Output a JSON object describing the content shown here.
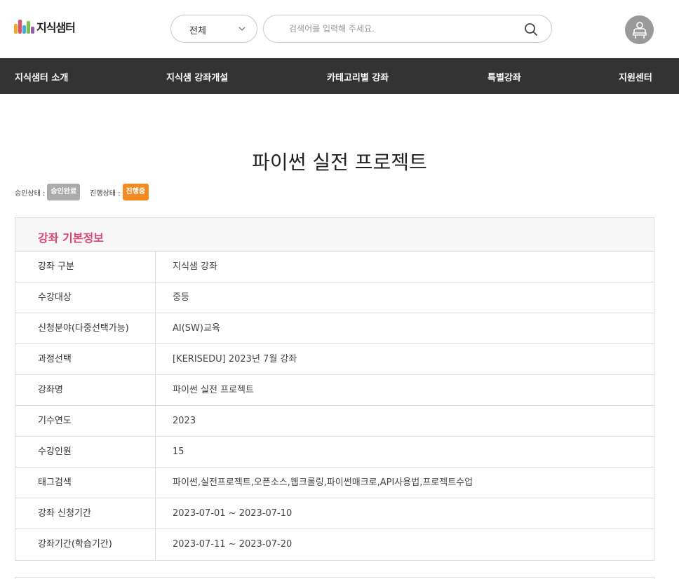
{
  "header": {
    "logo_text": "지식샘터",
    "category_select": {
      "selected": "전체"
    },
    "search": {
      "placeholder": "검색어를 입력해 주세요.",
      "value": ""
    }
  },
  "nav": {
    "items": [
      {
        "label": "지식샘터 소개"
      },
      {
        "label": "지식샘 강좌개설"
      },
      {
        "label": "카테고리별 강좌"
      },
      {
        "label": "특별강좌"
      },
      {
        "label": "지원센터"
      }
    ]
  },
  "course": {
    "title": "파이썬 실전 프로젝트",
    "approval_label": "승인상태 :",
    "approval_value": "승인완료",
    "progress_label": "진행상태 :",
    "progress_value": "진행중"
  },
  "info": {
    "heading": "강좌 기본정보",
    "rows": [
      {
        "key": "강좌 구분",
        "value": "지식샘 강좌"
      },
      {
        "key": "수강대상",
        "value": "중등"
      },
      {
        "key": "신청분야(다중선택가능)",
        "value": "AI(SW)교육"
      },
      {
        "key": "과정선택",
        "value": "[KERISEDU] 2023년 7월 강좌"
      },
      {
        "key": "강좌명",
        "value": "파이썬 실전 프로젝트"
      },
      {
        "key": "기수연도",
        "value": "2023"
      },
      {
        "key": "수강인원",
        "value": "15"
      },
      {
        "key": "태그검색",
        "value": "파이썬,실전프로젝트,오픈소스,웹크롤링,파이썬매크로,API사용법,프로젝트수업"
      },
      {
        "key": "강좌 신청기간",
        "value": "2023-07-01 ~ 2023-07-10"
      },
      {
        "key": "강좌기간(학습기간)",
        "value": "2023-07-11 ~ 2023-07-20"
      }
    ]
  },
  "colors": {
    "nav_bg": "#333333",
    "accent_pink": "#e0436d",
    "badge_gray": "#ababab",
    "badge_orange": "#f58a1f"
  },
  "icons": [
    "logo-mark-icon",
    "chevron-down-icon",
    "search-icon",
    "user-icon"
  ]
}
